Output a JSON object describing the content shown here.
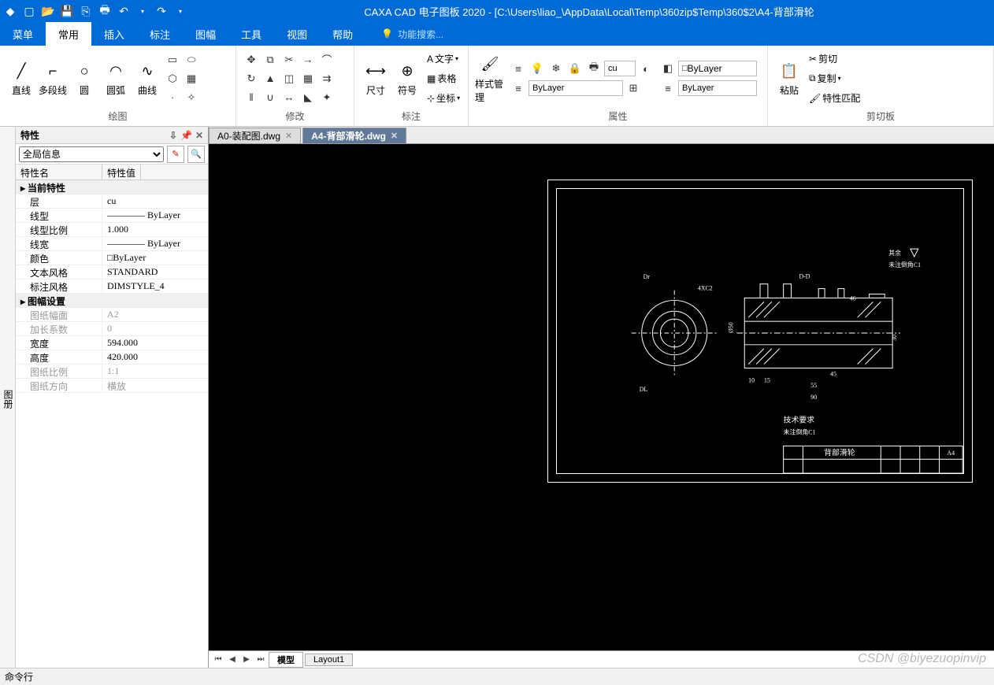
{
  "title": "CAXA CAD 电子图板 2020 - [C:\\Users\\liao_\\AppData\\Local\\Temp\\360zip$Temp\\360$2\\A4-背部滑轮",
  "menu": [
    "菜单",
    "常用",
    "插入",
    "标注",
    "图幅",
    "工具",
    "视图",
    "帮助"
  ],
  "active_menu": 1,
  "search_hint": "功能搜索...",
  "ribbon": {
    "draw": {
      "label": "绘图",
      "items": [
        "直线",
        "多段线",
        "圆",
        "圆弧",
        "曲线"
      ]
    },
    "modify": {
      "label": "修改"
    },
    "annotate": {
      "label": "标注",
      "size": "尺寸",
      "symbol": "符号",
      "text": "文字",
      "table": "表格",
      "coord": "坐标"
    },
    "style": {
      "label": "属性",
      "mgr": "样式管理",
      "layer": "cu",
      "line_combo": "ByLayer",
      "lw_combo": "ByLayer",
      "bylayer": "ByLayer"
    },
    "clipboard": {
      "label": "剪切板",
      "paste": "粘贴",
      "cut": "剪切",
      "copy": "复制",
      "match": "特性匹配"
    }
  },
  "panel": {
    "title": "特性",
    "filter": "全局信息",
    "col_name": "特性名",
    "col_val": "特性值",
    "rows": [
      {
        "cat": true,
        "n": "▸ 当前特性",
        "v": ""
      },
      {
        "n": "层",
        "v": "cu"
      },
      {
        "n": "线型",
        "v": "———— ByLayer"
      },
      {
        "n": "线型比例",
        "v": "1.000"
      },
      {
        "n": "线宽",
        "v": "———— ByLayer"
      },
      {
        "n": "颜色",
        "v": "□ByLayer"
      },
      {
        "n": "文本风格",
        "v": "STANDARD"
      },
      {
        "n": "标注风格",
        "v": "DIMSTYLE_4"
      },
      {
        "cat": true,
        "n": "▸ 图幅设置",
        "v": ""
      },
      {
        "dis": true,
        "n": "图纸幅面",
        "v": "A2"
      },
      {
        "dis": true,
        "n": "加长系数",
        "v": "0"
      },
      {
        "n": "宽度",
        "v": "594.000"
      },
      {
        "n": "高度",
        "v": "420.000"
      },
      {
        "dis": true,
        "n": "图纸比例",
        "v": "1:1"
      },
      {
        "dis": true,
        "n": "图纸方向",
        "v": "横放"
      }
    ]
  },
  "tabs": [
    {
      "label": "A0-装配图.dwg",
      "active": false
    },
    {
      "label": "A4-背部滑轮.dwg",
      "active": true
    }
  ],
  "layout_tabs": [
    "模型",
    "Layout1"
  ],
  "cmdline": "命令行",
  "drawing": {
    "title_block_name": "背部滑轮",
    "size": "A4",
    "tech_req": "技术要求",
    "note1": "未注倒角C1",
    "note2": "其余",
    "note3": "未注倒角C1",
    "dims": {
      "d10": "10",
      "d15": "15",
      "d45": "45",
      "d55": "55",
      "d90": "90",
      "d30": "30",
      "d46": "46",
      "d650": "Ø50",
      "dl": "DL",
      "dr": "Dr",
      "dd": "D-D",
      "c2": "4XC2"
    }
  },
  "watermark": "CSDN @biyezuopinvip"
}
